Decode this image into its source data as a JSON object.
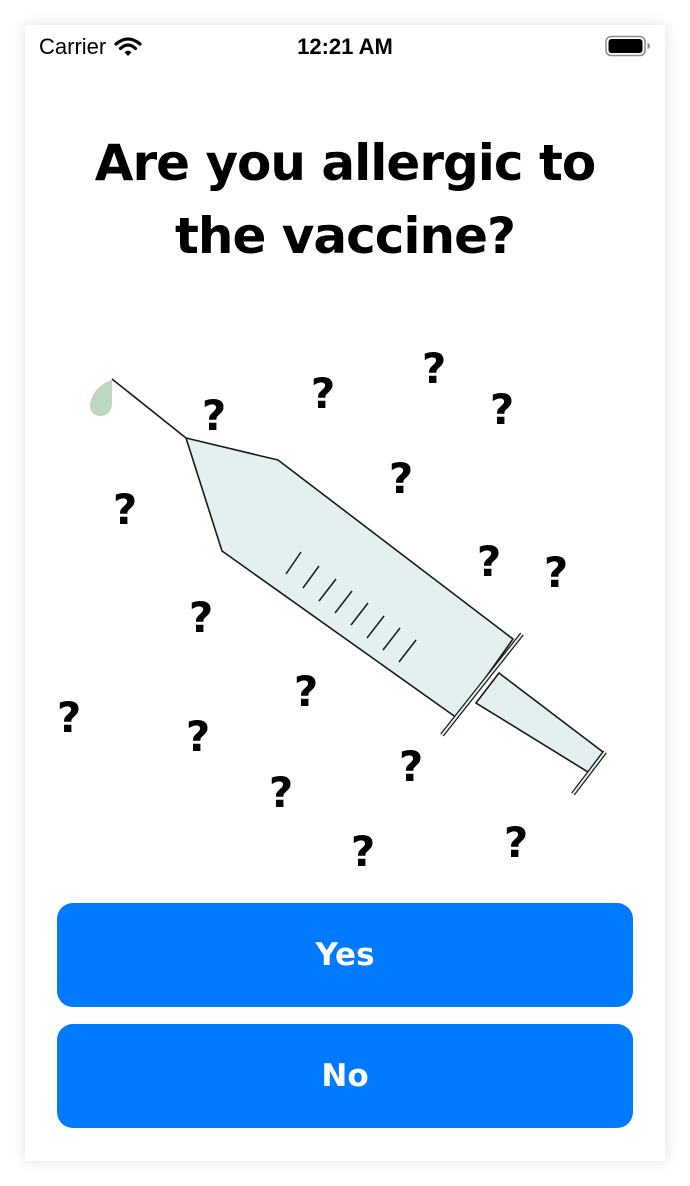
{
  "status_bar": {
    "carrier": "Carrier",
    "time": "12:21 AM",
    "icons": [
      "wifi-icon",
      "battery-icon"
    ]
  },
  "question": {
    "line1": "Are you allergic to",
    "line2": "the vaccine?"
  },
  "illustration": {
    "subject": "syringe-icon",
    "mark_glyph": "?",
    "colors": {
      "barrel_fill": "#e2f0ef",
      "droplet": "#bdd9bd",
      "outline": "#1a1a1a"
    }
  },
  "buttons": {
    "yes_label": "Yes",
    "no_label": "No",
    "accent_color": "#007aff"
  }
}
